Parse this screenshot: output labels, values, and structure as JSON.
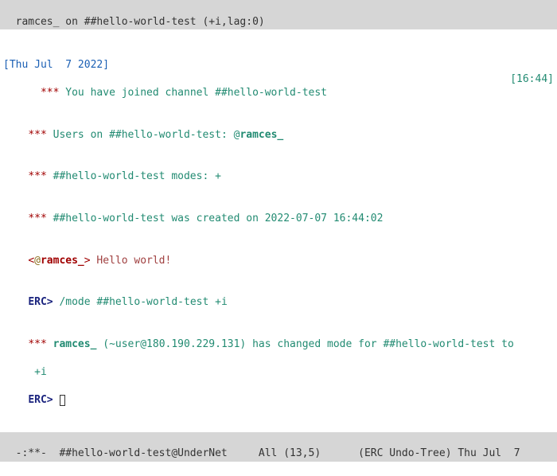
{
  "header": {
    "text": "ramces_ on ##hello-world-test (+i,lag:0)"
  },
  "buffer": {
    "date_stamp": "[Thu Jul  7 2022]",
    "join_line": {
      "prefix": "*** ",
      "text": "You have joined channel ##hello-world-test",
      "timestamp": "[16:44]"
    },
    "users_line": {
      "prefix": "*** ",
      "text": "Users on ##hello-world-test: @",
      "nick": "ramces_"
    },
    "modes_line": {
      "prefix": "*** ",
      "text": "##hello-world-test modes: +"
    },
    "created_line": {
      "prefix": "*** ",
      "text": "##hello-world-test was created on 2022-07-07 16:44:02"
    },
    "msg_line": {
      "open": "<",
      "op": "@",
      "nick": "ramces_",
      "close": ">",
      "message": " Hello world!"
    },
    "cmd_line": {
      "prompt": "ERC> ",
      "command": "/mode ##hello-world-test +i"
    },
    "mode_change_line": {
      "prefix": "*** ",
      "nick": "ramces_",
      "tail": " (~user@180.190.229.131) has changed mode for ##hello-world-test to",
      "continuation": "+i"
    },
    "prompt_line": {
      "prompt": "ERC> "
    }
  },
  "modeline": {
    "text": "-:**-  ##hello-world-test@UnderNet     All (13,5)      (ERC Undo-Tree) Thu Jul  7"
  }
}
